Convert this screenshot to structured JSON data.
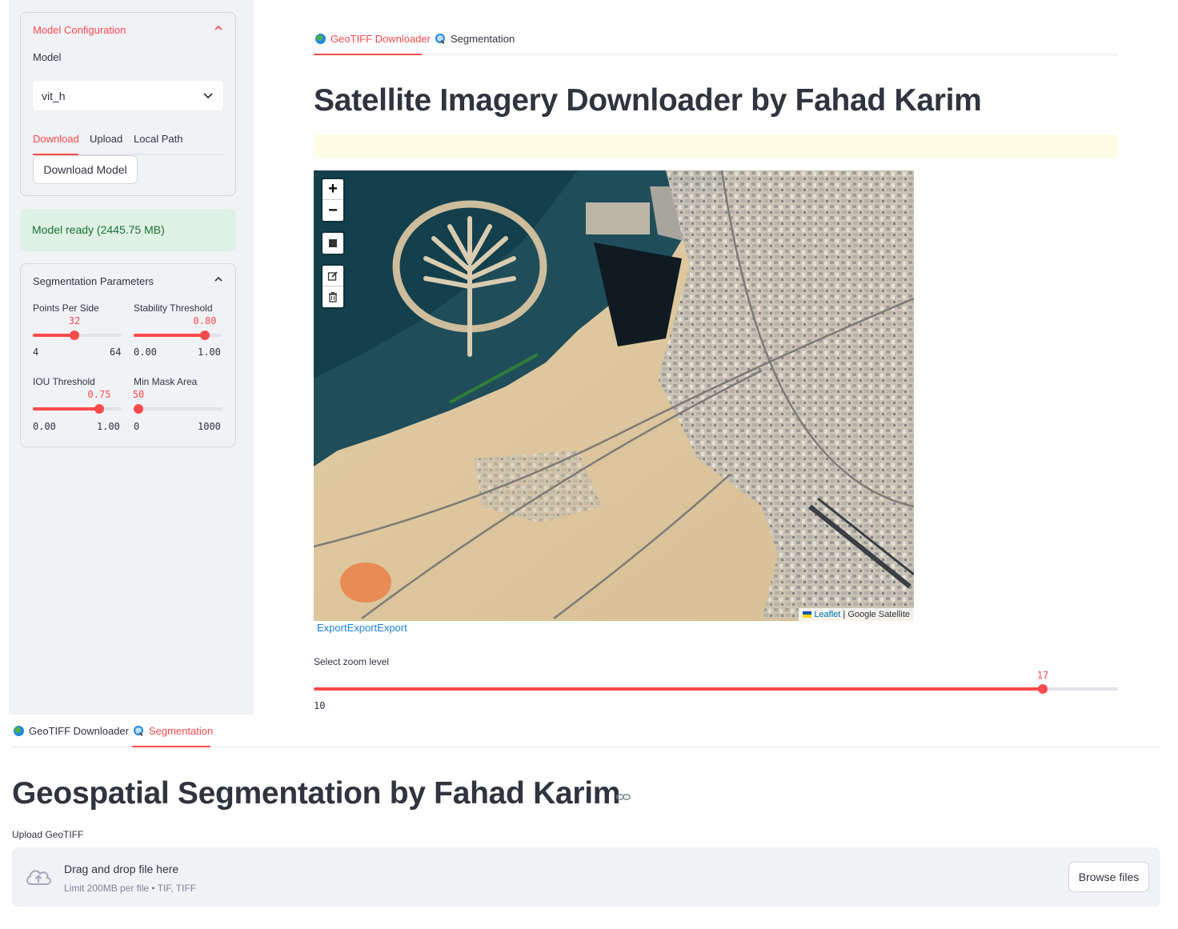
{
  "sidebar": {
    "model_config": {
      "title": "Model Configuration",
      "model_label": "Model",
      "model_value": "vit_h",
      "tabs": [
        "Download",
        "Upload",
        "Local Path"
      ],
      "download_button": "Download Model"
    },
    "status": "Model ready (2445.75 MB)",
    "seg_params": {
      "title": "Segmentation Parameters",
      "sliders": [
        {
          "label": "Points Per Side",
          "value": "32",
          "min": "4",
          "max": "64",
          "fraction": 0.47
        },
        {
          "label": "Stability Threshold",
          "value": "0.80",
          "min": "0.00",
          "max": "1.00",
          "fraction": 0.8
        },
        {
          "label": "IOU Threshold",
          "value": "0.75",
          "min": "0.00",
          "max": "1.00",
          "fraction": 0.75
        },
        {
          "label": "Min Mask Area",
          "value": "50",
          "min": "0",
          "max": "1000",
          "fraction": 0.05
        }
      ]
    }
  },
  "main_tabs": [
    {
      "label": "GeoTIFF Downloader",
      "icon": "globe-icon"
    },
    {
      "label": "Segmentation",
      "icon": "magnifier-icon"
    }
  ],
  "downloader": {
    "title": "Satellite Imagery Downloader by Fahad Karim",
    "map": {
      "zoom_in": "+",
      "zoom_out": "−",
      "attribution_link": "Leaflet",
      "attribution_sep": " | ",
      "attribution_text": "Google Satellite"
    },
    "export_link": "ExportExportExport",
    "zoom_slider": {
      "label": "Select zoom level",
      "value": "17",
      "min": "10",
      "fraction": 0.906
    }
  },
  "segmentation": {
    "title": "Geospatial Segmentation by Fahad Karim",
    "upload_label": "Upload GeoTIFF",
    "drop_text": "Drag and drop file here",
    "limit_text": "Limit 200MB per file • TIF, TIFF",
    "browse_button": "Browse files"
  },
  "colors": {
    "accent": "#ff4b4b",
    "sidebar_bg": "#f0f2f6",
    "success_bg": "#dff0e4",
    "link": "#1c83e1"
  }
}
